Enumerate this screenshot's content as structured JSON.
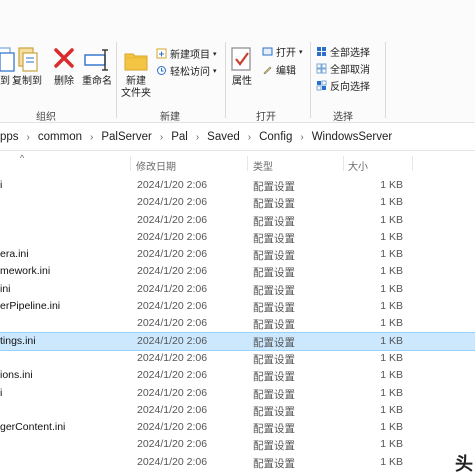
{
  "ribbon": {
    "clipboard": {
      "copy_to_label": "到",
      "copy_to_prefix": "复制到",
      "delete_label": "删除",
      "rename_label": "重命名",
      "group_label": "组织"
    },
    "new": {
      "new_folder_label": "新建\n文件夹",
      "new_item_label": "新建项目",
      "easy_access_label": "轻松访问",
      "group_label": "新建"
    },
    "open": {
      "properties_label": "属性",
      "open_label": "打开",
      "edit_label": "编辑",
      "group_label": "打开"
    },
    "select": {
      "select_all_label": "全部选择",
      "select_none_label": "全部取消",
      "invert_label": "反向选择",
      "group_label": "选择"
    }
  },
  "address": {
    "crumbs": [
      "pps",
      "common",
      "PalServer",
      "Pal",
      "Saved",
      "Config",
      "WindowsServer"
    ]
  },
  "columns": {
    "date": "修改日期",
    "type": "类型",
    "size": "大小"
  },
  "files": [
    {
      "name": "i",
      "date": "2024/1/20 2:06",
      "type": "配置设置",
      "size": "1 KB"
    },
    {
      "name": "",
      "date": "2024/1/20 2:06",
      "type": "配置设置",
      "size": "1 KB"
    },
    {
      "name": "",
      "date": "2024/1/20 2:06",
      "type": "配置设置",
      "size": "1 KB"
    },
    {
      "name": "",
      "date": "2024/1/20 2:06",
      "type": "配置设置",
      "size": "1 KB"
    },
    {
      "name": "era.ini",
      "date": "2024/1/20 2:06",
      "type": "配置设置",
      "size": "1 KB"
    },
    {
      "name": "mework.ini",
      "date": "2024/1/20 2:06",
      "type": "配置设置",
      "size": "1 KB"
    },
    {
      "name": "ini",
      "date": "2024/1/20 2:06",
      "type": "配置设置",
      "size": "1 KB"
    },
    {
      "name": "erPipeline.ini",
      "date": "2024/1/20 2:06",
      "type": "配置设置",
      "size": "1 KB"
    },
    {
      "name": "",
      "date": "2024/1/20 2:06",
      "type": "配置设置",
      "size": "1 KB"
    },
    {
      "name": "tings.ini",
      "date": "2024/1/20 2:06",
      "type": "配置设置",
      "size": "1 KB"
    },
    {
      "name": "",
      "date": "2024/1/20 2:06",
      "type": "配置设置",
      "size": "1 KB"
    },
    {
      "name": "ions.ini",
      "date": "2024/1/20 2:06",
      "type": "配置设置",
      "size": "1 KB"
    },
    {
      "name": "i",
      "date": "2024/1/20 2:06",
      "type": "配置设置",
      "size": "1 KB"
    },
    {
      "name": "",
      "date": "2024/1/20 2:06",
      "type": "配置设置",
      "size": "1 KB"
    },
    {
      "name": "gerContent.ini",
      "date": "2024/1/20 2:06",
      "type": "配置设置",
      "size": "1 KB"
    },
    {
      "name": "",
      "date": "2024/1/20 2:06",
      "type": "配置设置",
      "size": "1 KB"
    },
    {
      "name": "",
      "date": "2024/1/20 2:06",
      "type": "配置设置",
      "size": "1 KB"
    }
  ],
  "selected_row_index": 9,
  "watermark": "头",
  "colors": {
    "selection_bg": "#cce8ff",
    "selection_border": "#99d1ff",
    "delete_red": "#d92b2b",
    "folder_yellow": "#f4c542",
    "accent_blue": "#2a6fc9"
  }
}
